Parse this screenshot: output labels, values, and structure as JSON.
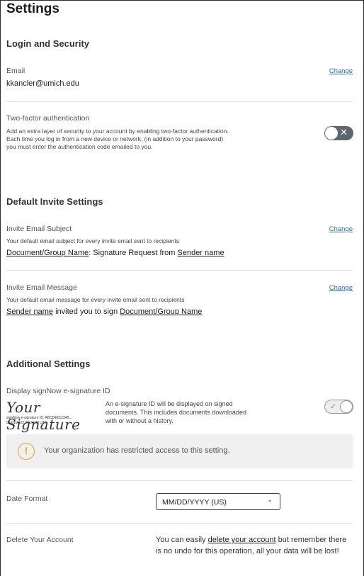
{
  "page_title": "Settings",
  "login_security": {
    "title": "Login and Security",
    "email": {
      "label": "Email",
      "value": "kkancler@umich.edu",
      "change": "Change"
    },
    "two_factor": {
      "label": "Two-factor authentication",
      "desc_1": "Add an extra layer of security to your account by enabling two-factor authentication.",
      "desc_2": "Each time you log in from a new device or network, (in addition to your password)",
      "desc_3": "you must enter the authentication code emailed to you.",
      "enabled": false
    }
  },
  "invite_settings": {
    "title": "Default Invite Settings",
    "subject": {
      "label": "Invite Email Subject",
      "desc": "Your default email subject for every invite email sent to recipients",
      "part_1": "Document/Group Name",
      "part_2": ": Signature Request from ",
      "part_3": "Sender name",
      "change": "Change"
    },
    "message": {
      "label": "Invite Email Message",
      "desc": "Your default email message for every invite email sent to recipients",
      "part_1": "Sender name",
      "part_2": " invited you to sign ",
      "part_3": "Document/Group Name",
      "change": "Change"
    }
  },
  "additional": {
    "title": "Additional Settings",
    "esig": {
      "label": "Display signNow e-signature ID",
      "signature": "Your Signature",
      "sig_id": "signNow e-signature ID: ABCDE012345...",
      "sig_date": "01/01/2022 00:00:00 UTC",
      "desc_1": "An e-signature ID will be displayed on signed",
      "desc_2": "documents. This includes documents downloaded",
      "desc_3": "with or without a history.",
      "enabled": true
    },
    "notice": "Your organization has restricted access to this setting.",
    "date_format": {
      "label": "Date Format",
      "value": "MM/DD/YYYY (US)"
    },
    "delete_account": {
      "label": "Delete Your Account",
      "text_1": "You can easily ",
      "link": "delete your account",
      "text_2": " but remember there is no undo for this operation, all your data will be lost!"
    }
  },
  "colors": {
    "link": "#2f6fa7",
    "toggle_off": "#5e6670",
    "warning": "#e5a12a"
  }
}
